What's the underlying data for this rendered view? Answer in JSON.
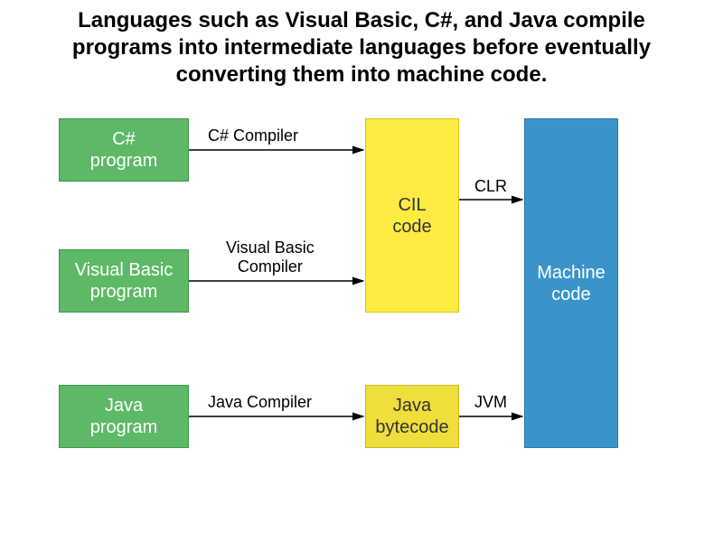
{
  "title": "Languages such as Visual Basic, C#, and Java compile programs into intermediate languages before eventually converting them into machine code.",
  "boxes": {
    "csharp_program": "C#\nprogram",
    "vb_program": "Visual Basic\nprogram",
    "java_program": "Java\nprogram",
    "cil_code": "CIL\ncode",
    "java_bytecode": "Java\nbytecode",
    "machine_code": "Machine\ncode"
  },
  "arrows": {
    "csharp_compiler": "C# Compiler",
    "vb_compiler": "Visual Basic\nCompiler",
    "java_compiler": "Java Compiler",
    "clr": "CLR",
    "jvm": "JVM"
  }
}
